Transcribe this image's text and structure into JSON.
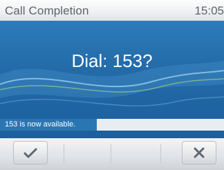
{
  "window": {
    "title": "Call Completion",
    "clock": "15:05"
  },
  "main": {
    "prompt": "Dial: 153?"
  },
  "status": {
    "message": "153 is now available."
  },
  "softkeys": {
    "ok_icon": "checkmark-icon",
    "cancel_icon": "close-icon"
  },
  "colors": {
    "background_blue": "#236ba9",
    "title_text": "#5e646b"
  }
}
